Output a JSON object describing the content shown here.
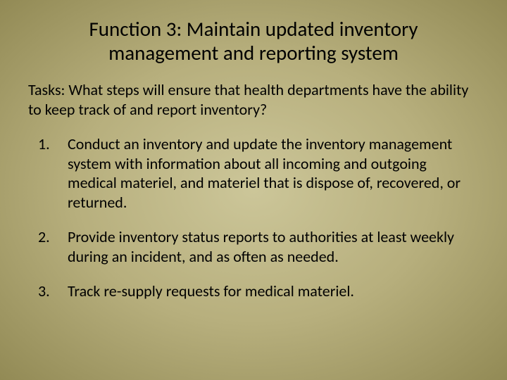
{
  "title": "Function 3: Maintain updated inventory management and reporting system",
  "tasks_prompt": "Tasks: What steps will ensure that health departments have the ability to keep track of and report inventory?",
  "items": [
    "Conduct an inventory and update the inventory management system with information about all incoming and outgoing medical materiel, and materiel that is dispose of, recovered, or returned.",
    "Provide inventory status reports to authorities at least weekly during an incident, and as often as needed.",
    "Track re-supply requests for medical materiel."
  ]
}
